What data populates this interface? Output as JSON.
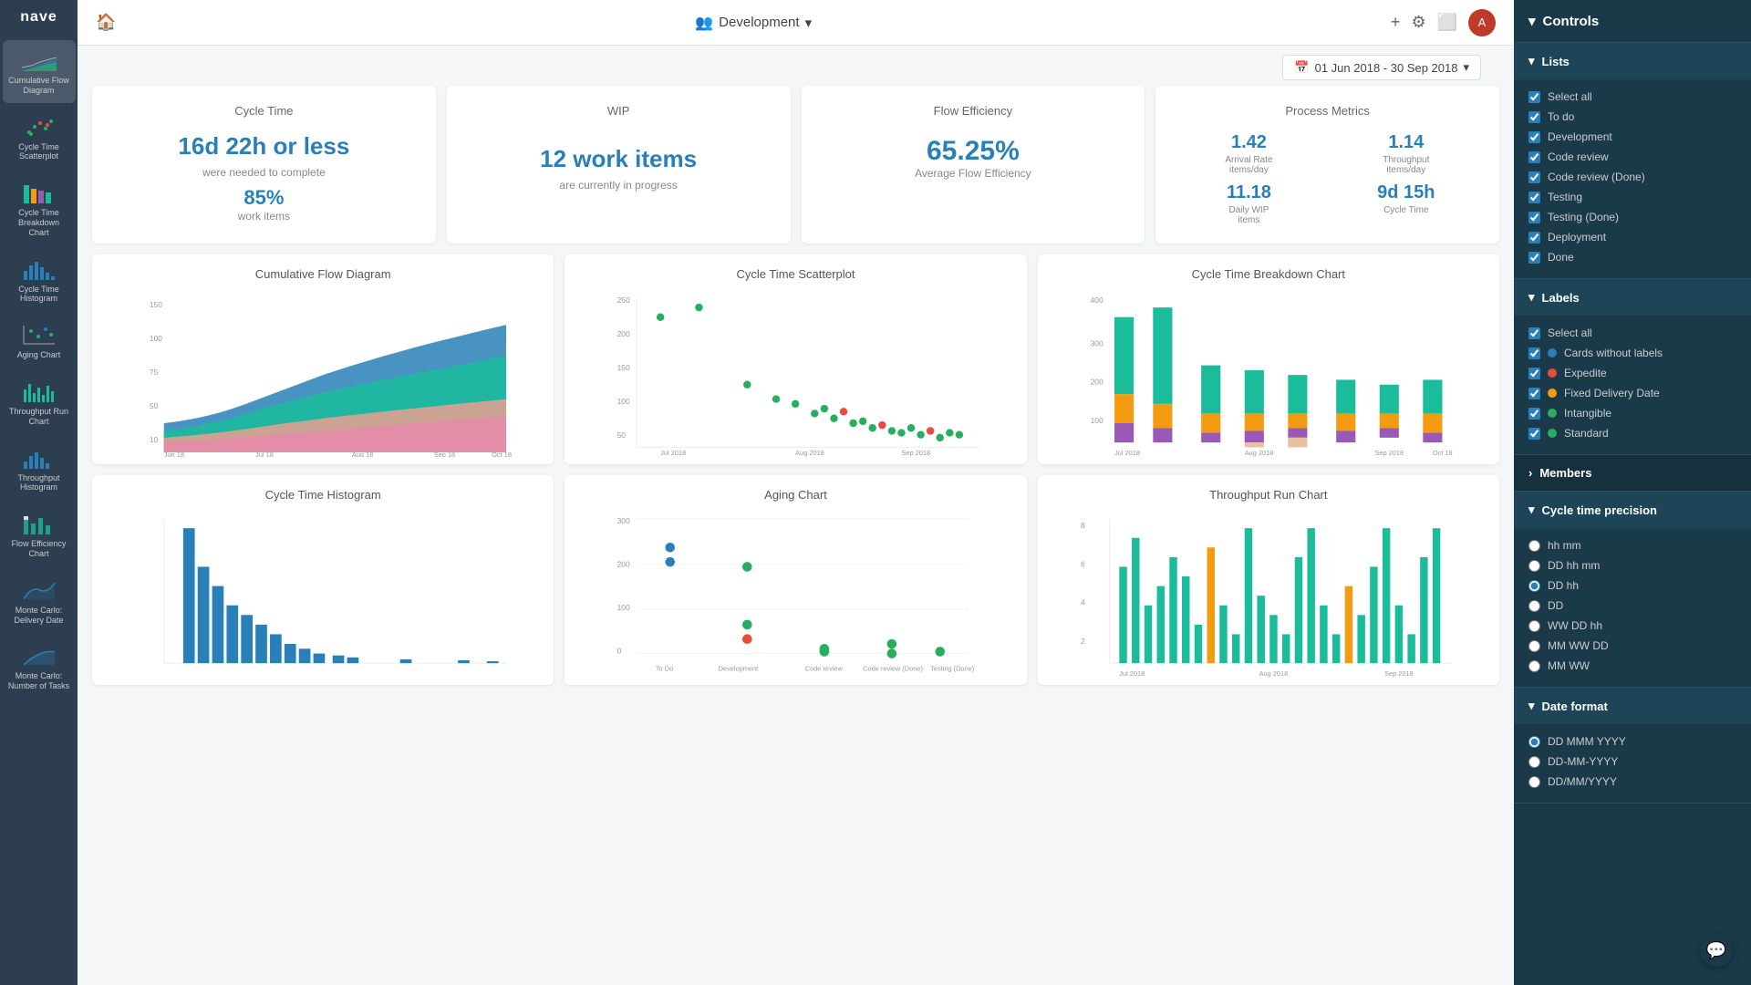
{
  "app": {
    "name": "nave"
  },
  "topbar": {
    "home_label": "🏠",
    "project_name": "Development",
    "chevron": "▾",
    "plus": "+",
    "gear": "⚙",
    "monitor": "🖥",
    "date_range": "01 Jun 2018 - 30 Sep 2018",
    "calendar_icon": "📅"
  },
  "metrics": {
    "cycle_time": {
      "title": "Cycle Time",
      "value": "16d 22h or less",
      "subtitle": "were needed to complete",
      "pct": "85%",
      "pct_label": "work items"
    },
    "wip": {
      "title": "WIP",
      "value": "12 work items",
      "subtitle": "are currently in progress"
    },
    "flow_efficiency": {
      "title": "Flow Efficiency",
      "value": "65.25%",
      "subtitle": "Average Flow Efficiency"
    },
    "process_metrics": {
      "title": "Process Metrics",
      "arrival_rate_value": "1.42",
      "arrival_rate_label": "Arrival Rate\nitems/day",
      "throughput_value": "1.14",
      "throughput_label": "Throughput\nitems/day",
      "daily_wip_value": "11.18",
      "daily_wip_label": "Daily WIP\nitems",
      "cycle_time_value": "9d 15h",
      "cycle_time_label": "Cycle Time"
    }
  },
  "charts_row1": [
    {
      "title": "Cumulative Flow Diagram"
    },
    {
      "title": "Cycle Time Scatterplot"
    },
    {
      "title": "Cycle Time Breakdown Chart"
    }
  ],
  "charts_row2": [
    {
      "title": "Cycle Time Histogram"
    },
    {
      "title": "Aging Chart"
    },
    {
      "title": "Throughput Run Chart"
    }
  ],
  "controls": {
    "header": "Controls",
    "lists_section": "Lists",
    "lists_items": [
      {
        "label": "Select all",
        "checked": true,
        "color": null
      },
      {
        "label": "To do",
        "checked": true,
        "color": null
      },
      {
        "label": "Development",
        "checked": true,
        "color": null
      },
      {
        "label": "Code review",
        "checked": true,
        "color": null
      },
      {
        "label": "Code review (Done)",
        "checked": true,
        "color": null
      },
      {
        "label": "Testing",
        "checked": true,
        "color": null
      },
      {
        "label": "Testing (Done)",
        "checked": true,
        "color": null
      },
      {
        "label": "Deployment",
        "checked": true,
        "color": null
      },
      {
        "label": "Done",
        "checked": true,
        "color": null
      }
    ],
    "labels_section": "Labels",
    "labels_items": [
      {
        "label": "Select all",
        "checked": true,
        "color": null
      },
      {
        "label": "Cards without labels",
        "checked": true,
        "color": "#2980b9"
      },
      {
        "label": "Expedite",
        "checked": true,
        "color": "#e74c3c"
      },
      {
        "label": "Fixed Delivery Date",
        "checked": true,
        "color": "#f39c12"
      },
      {
        "label": "Intangible",
        "checked": true,
        "color": "#27ae60"
      },
      {
        "label": "Standard",
        "checked": true,
        "color": "#27ae60"
      }
    ],
    "members_section": "Members",
    "cycle_time_precision_section": "Cycle time precision",
    "precision_items": [
      {
        "label": "hh mm",
        "selected": false
      },
      {
        "label": "DD hh mm",
        "selected": false
      },
      {
        "label": "DD hh",
        "selected": true
      },
      {
        "label": "DD",
        "selected": false
      },
      {
        "label": "WW DD hh",
        "selected": false
      },
      {
        "label": "MM WW DD",
        "selected": false
      },
      {
        "label": "MM WW",
        "selected": false
      }
    ],
    "date_format_section": "Date format",
    "date_format_items": [
      {
        "label": "DD MMM YYYY",
        "selected": true
      },
      {
        "label": "DD-MM-YYYY",
        "selected": false
      },
      {
        "label": "DD/MM/YYYY",
        "selected": false
      }
    ]
  },
  "sidebar": {
    "items": [
      {
        "label": "Cumulative Flow\nDiagram",
        "active": true
      },
      {
        "label": "Cycle Time\nScatterplot",
        "active": false
      },
      {
        "label": "Cycle Time\nBreakdown Chart",
        "active": false
      },
      {
        "label": "Cycle Time\nHistogram",
        "active": false
      },
      {
        "label": "Aging Chart",
        "active": false
      },
      {
        "label": "Throughput Run\nChart",
        "active": false
      },
      {
        "label": "Throughput\nHistogram",
        "active": false
      },
      {
        "label": "Flow Efficiency\nChart",
        "active": false
      },
      {
        "label": "Monte Carlo:\nDelivery Date",
        "active": false
      },
      {
        "label": "Monte Carlo:\nNumber of Tasks",
        "active": false
      }
    ]
  }
}
